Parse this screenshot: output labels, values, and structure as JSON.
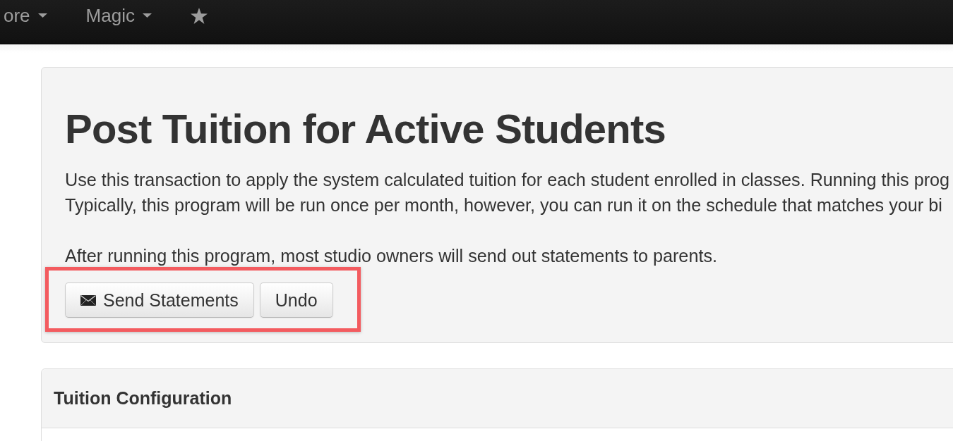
{
  "navbar": {
    "items": [
      {
        "kind": "dropdown",
        "label": "ore"
      },
      {
        "kind": "dropdown",
        "label": "Magic"
      },
      {
        "kind": "star"
      }
    ]
  },
  "hero": {
    "title": "Post Tuition for Active Students",
    "description_lines": [
      "Use this transaction to apply the system calculated tuition for each student enrolled in classes. Running this prog",
      "Typically, this program will be run once per month, however, you can run it on the schedule that matches your bi"
    ],
    "note": "After running this program, most studio owners will send out statements to parents.",
    "actions": {
      "highlighted": true,
      "buttons": [
        {
          "kind": "mail",
          "label": "Send Statements"
        },
        {
          "kind": "plain",
          "label": "Undo"
        }
      ]
    }
  },
  "sections": [
    {
      "title": "Tuition Configuration"
    }
  ]
}
